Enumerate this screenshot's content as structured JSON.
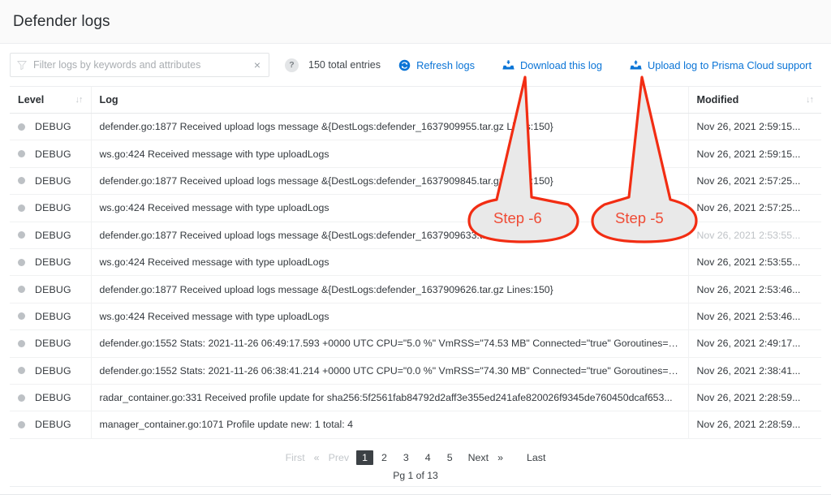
{
  "header": {
    "title": "Defender logs"
  },
  "toolbar": {
    "filter_placeholder": "Filter logs by keywords and attributes",
    "filter_value": "",
    "clear_label": "×",
    "help_label": "?",
    "total_entries": "150 total entries",
    "refresh_label": "Refresh logs",
    "download_label": "Download this log",
    "upload_label": "Upload log to Prisma Cloud support",
    "link_color": "#0a74d6"
  },
  "table": {
    "columns": [
      "Level",
      "Log",
      "Modified"
    ],
    "sort_glyph": "↓↑",
    "rows": [
      {
        "level": "DEBUG",
        "log": "defender.go:1877 Received upload logs message &{DestLogs:defender_1637909955.tar.gz Lines:150}",
        "modified": "Nov 26, 2021 2:59:15...",
        "dim": false
      },
      {
        "level": "DEBUG",
        "log": "ws.go:424 Received message with type uploadLogs",
        "modified": "Nov 26, 2021 2:59:15...",
        "dim": false
      },
      {
        "level": "DEBUG",
        "log": "defender.go:1877 Received upload logs message &{DestLogs:defender_1637909845.tar.gz Lines:150}",
        "modified": "Nov 26, 2021 2:57:25...",
        "dim": false
      },
      {
        "level": "DEBUG",
        "log": "ws.go:424 Received message with type uploadLogs",
        "modified": "Nov 26, 2021 2:57:25...",
        "dim": false
      },
      {
        "level": "DEBUG",
        "log": "defender.go:1877 Received upload logs message &{DestLogs:defender_1637909633.tar.gz Lines:150}",
        "modified": "Nov 26, 2021 2:53:55...",
        "dim": true
      },
      {
        "level": "DEBUG",
        "log": "ws.go:424 Received message with type uploadLogs",
        "modified": "Nov 26, 2021 2:53:55...",
        "dim": false
      },
      {
        "level": "DEBUG",
        "log": "defender.go:1877 Received upload logs message &{DestLogs:defender_1637909626.tar.gz Lines:150}",
        "modified": "Nov 26, 2021 2:53:46...",
        "dim": false
      },
      {
        "level": "DEBUG",
        "log": "ws.go:424 Received message with type uploadLogs",
        "modified": "Nov 26, 2021 2:53:46...",
        "dim": false
      },
      {
        "level": "DEBUG",
        "log": "defender.go:1552 Stats: 2021-11-26 06:49:17.593 +0000 UTC CPU=\"5.0 %\" VmRSS=\"74.53 MB\" Connected=\"true\" Goroutines=\"...",
        "modified": "Nov 26, 2021 2:49:17...",
        "dim": false
      },
      {
        "level": "DEBUG",
        "log": "defender.go:1552 Stats: 2021-11-26 06:38:41.214 +0000 UTC CPU=\"0.0 %\" VmRSS=\"74.30 MB\" Connected=\"true\" Goroutines=\"...",
        "modified": "Nov 26, 2021 2:38:41...",
        "dim": false
      },
      {
        "level": "DEBUG",
        "log": "radar_container.go:331 Received profile update for sha256:5f2561fab84792d2aff3e355ed241afe820026f9345de760450dcaf653...",
        "modified": "Nov 26, 2021 2:28:59...",
        "dim": false
      },
      {
        "level": "DEBUG",
        "log": "manager_container.go:1071 Profile update new: 1 total: 4",
        "modified": "Nov 26, 2021 2:28:59...",
        "dim": false
      }
    ]
  },
  "pagination": {
    "first": "First",
    "prev": "Prev",
    "prev_chevron": "«",
    "pages": [
      "1",
      "2",
      "3",
      "4",
      "5"
    ],
    "active_page": "1",
    "next": "Next",
    "next_chevron": "»",
    "last": "Last",
    "page_status": "Pg 1 of 13"
  },
  "annotations": {
    "color": "#ef4b35",
    "callouts": [
      {
        "label": "Step -6"
      },
      {
        "label": "Step -5"
      }
    ]
  }
}
